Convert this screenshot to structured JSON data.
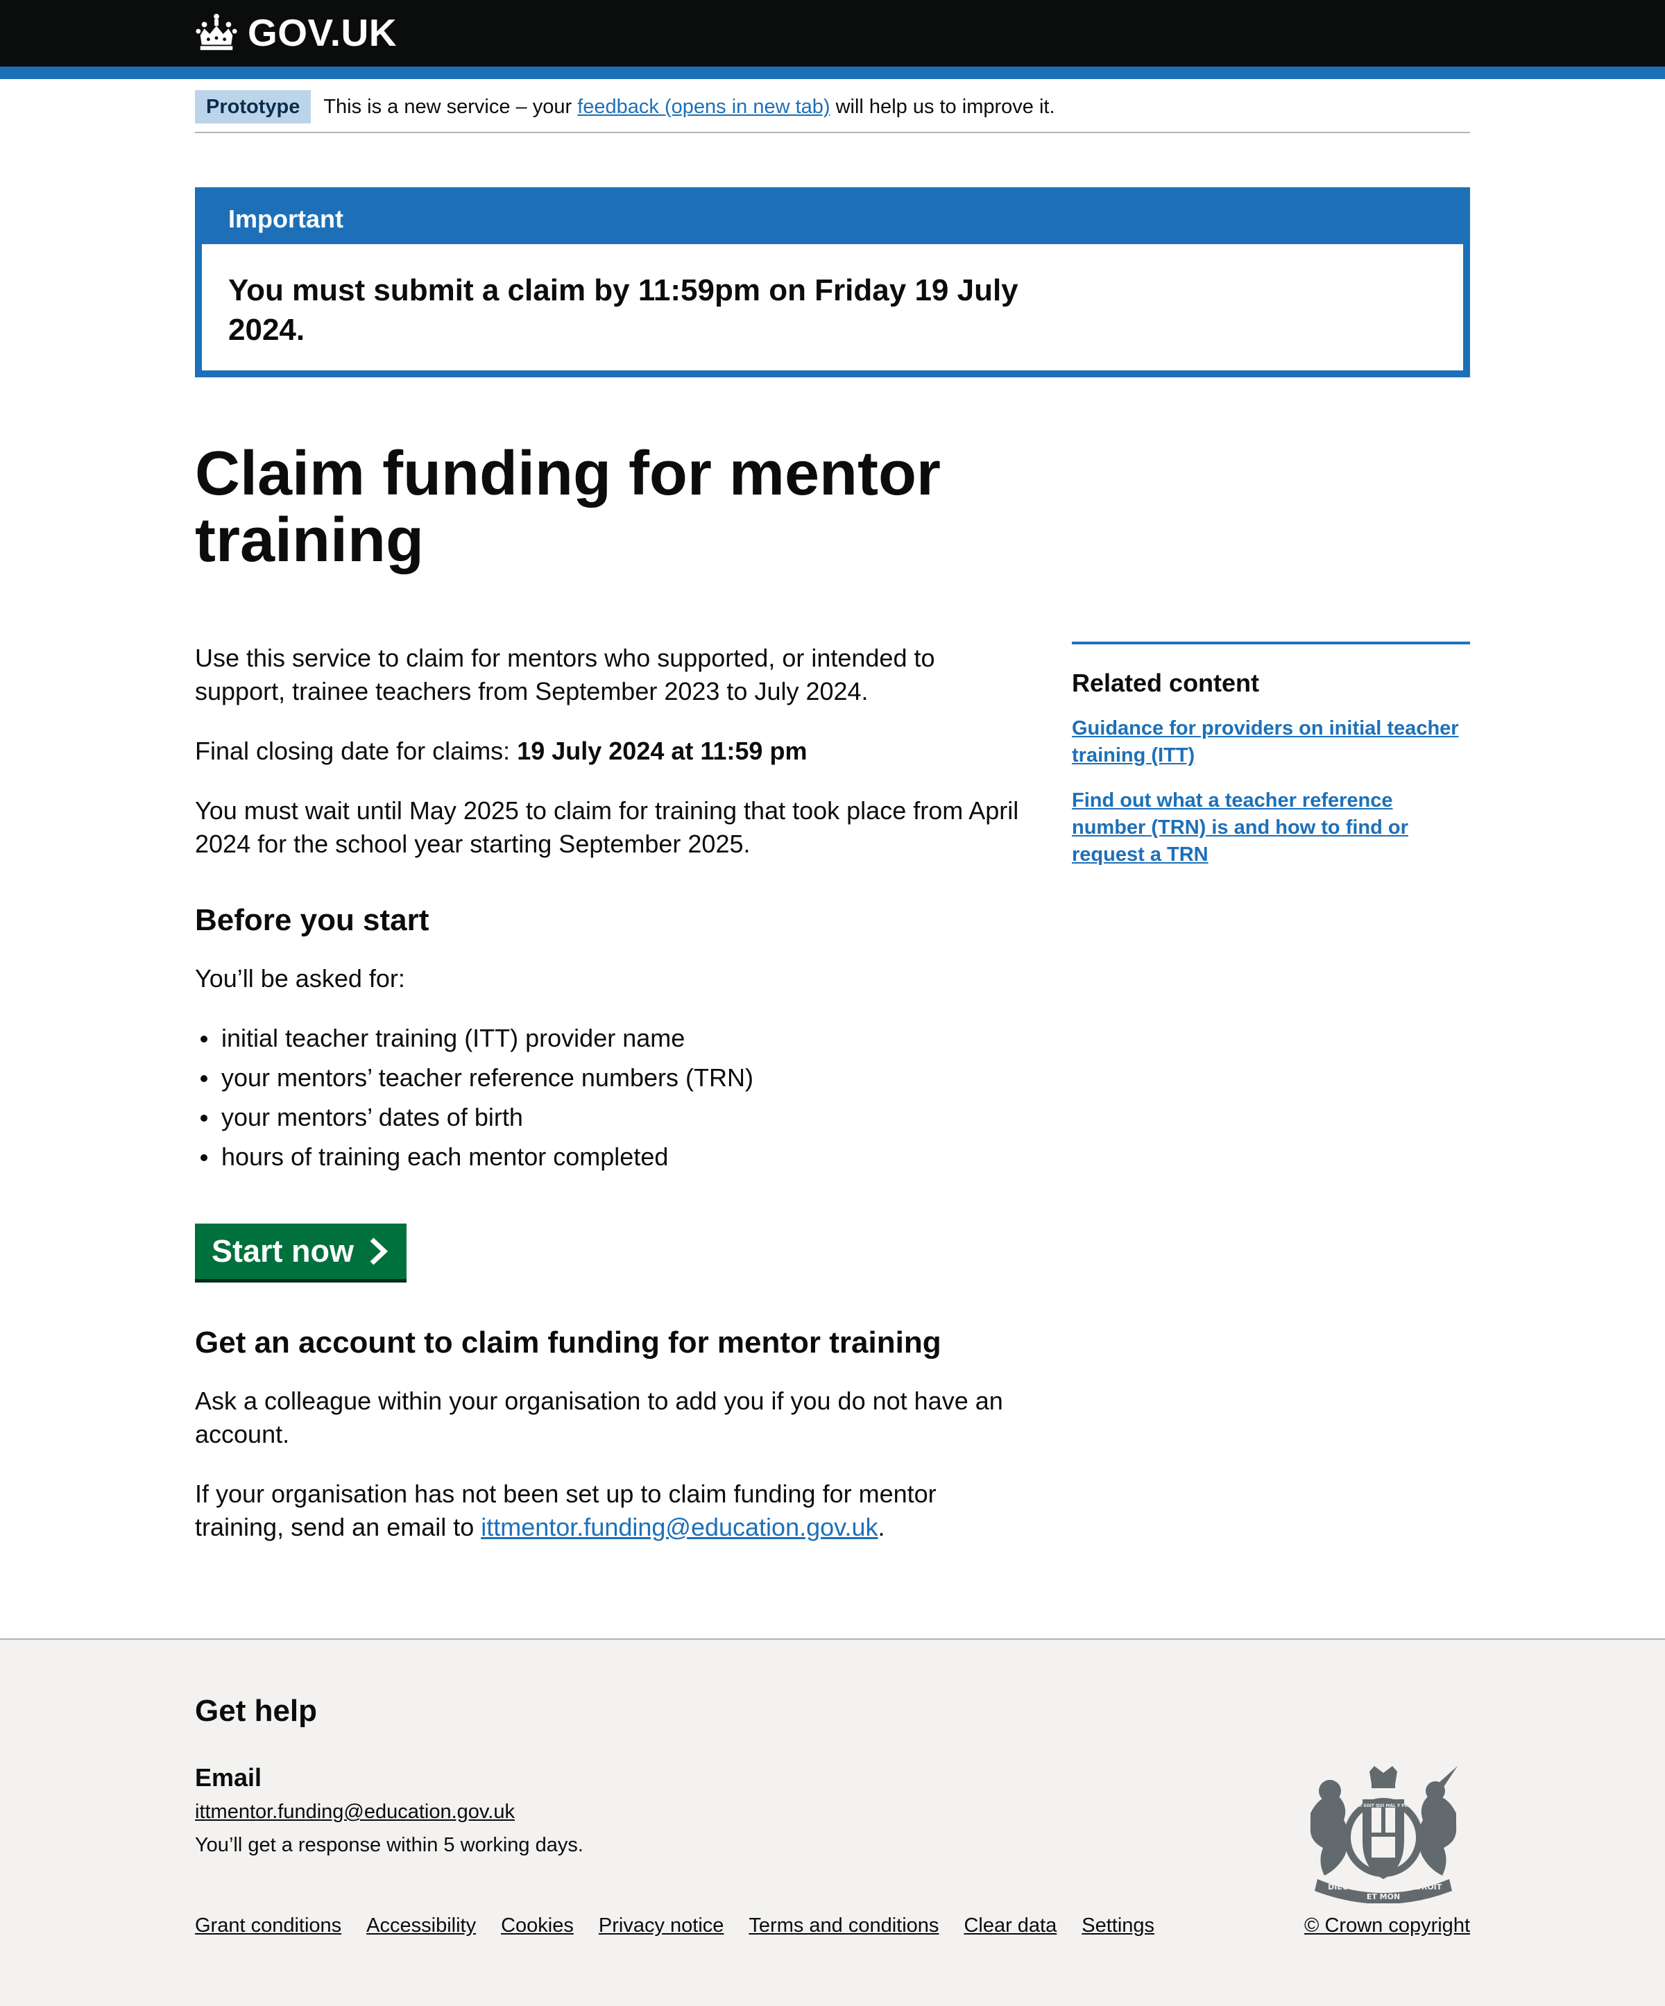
{
  "header": {
    "logo_text": "GOV.UK",
    "brand_color": "#1d70b8",
    "background": "#0b0c0c"
  },
  "phase_banner": {
    "tag": "Prototype",
    "text_before": "This is a new service – your ",
    "link_text": "feedback (opens in new tab)",
    "text_after": " will help us to improve it."
  },
  "notification": {
    "title": "Important",
    "heading": "You must submit a claim by 11:59pm on Friday 19 July 2024."
  },
  "page": {
    "title": "Claim funding for mentor training"
  },
  "main": {
    "intro": "Use this service to claim for mentors who supported, or intended to support, trainee teachers from September 2023 to July 2024.",
    "closing_label": "Final closing date for claims: ",
    "closing_date": "19 July 2024 at 11:59 pm",
    "wait_text": "You must wait until May 2025 to claim for training that took place from April 2024 for the school year starting September 2025.",
    "before_heading": "Before you start",
    "asked_for": "You’ll be asked for:",
    "items": [
      "initial teacher training (ITT) provider name",
      "your mentors’ teacher reference numbers (TRN)",
      "your mentors’ dates of birth",
      "hours of training each mentor completed"
    ],
    "start_button": "Start now",
    "account_heading": "Get an account to claim funding for mentor training",
    "account_text": "Ask a colleague within your organisation to add you if you do not have an account.",
    "org_text": "If your organisation has not been set up to claim funding for mentor training, send an email to ",
    "org_email": "ittmentor.funding@education.gov.uk",
    "org_end": "."
  },
  "related": {
    "title": "Related content",
    "links": [
      "Guidance for providers on initial teacher training (ITT)",
      "Find out what a teacher reference number (TRN) is and how to find or request a TRN"
    ]
  },
  "footer": {
    "help_heading": "Get help",
    "email_heading": "Email",
    "email": "ittmentor.funding@education.gov.uk",
    "response": "You’ll get a response within 5 working days.",
    "links": [
      "Grant conditions",
      "Accessibility",
      "Cookies",
      "Privacy notice",
      "Terms and conditions",
      "Clear data",
      "Settings"
    ],
    "copyright": "© Crown copyright",
    "crest_text": {
      "top": "HONI SOIT QUI MAL Y PENSE",
      "left": "DIEU",
      "center": "ET MON",
      "right": "DROIT"
    }
  }
}
